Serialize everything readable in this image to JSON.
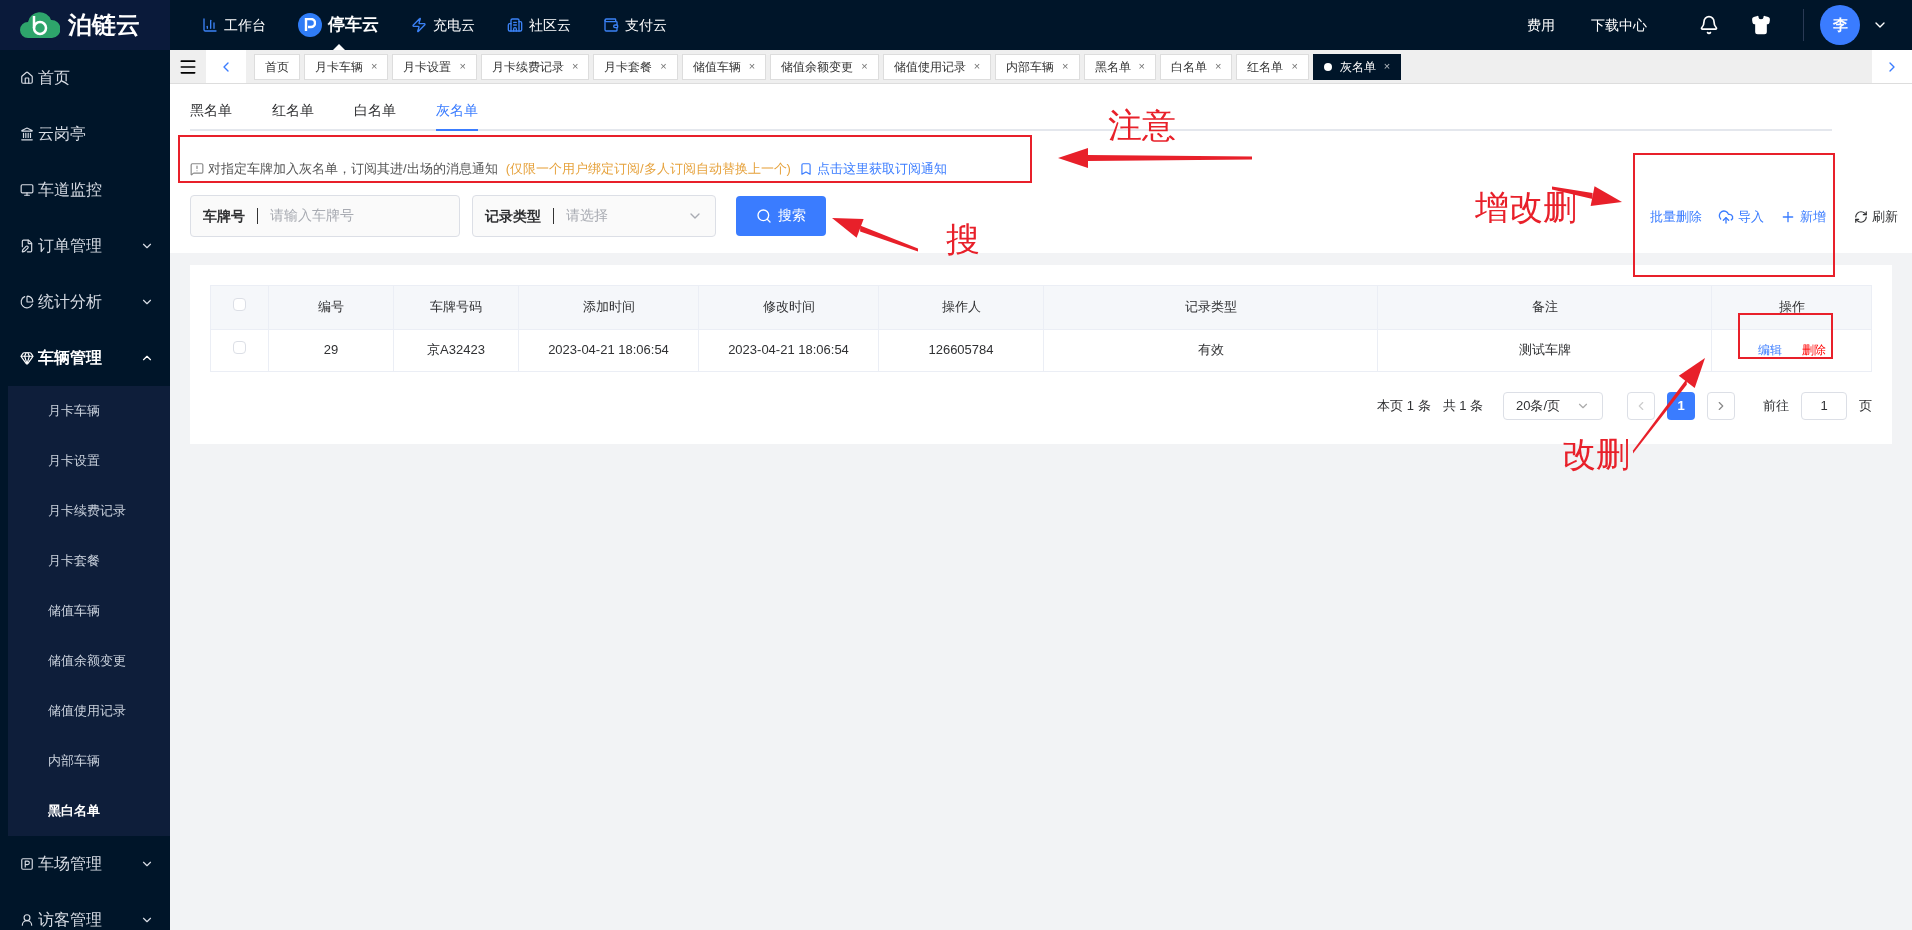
{
  "brand": {
    "name": "泊链云"
  },
  "top_nav": [
    {
      "label": "工作台",
      "selected": false
    },
    {
      "label": "停车云",
      "selected": true
    },
    {
      "label": "充电云",
      "selected": false
    },
    {
      "label": "社区云",
      "selected": false
    },
    {
      "label": "支付云",
      "selected": false
    }
  ],
  "top_right": {
    "links": [
      "费用",
      "下载中心"
    ],
    "avatar": "李"
  },
  "sidebar": {
    "items": [
      {
        "label": "首页",
        "expanded": false,
        "has_children": false
      },
      {
        "label": "云岗亭",
        "expanded": false,
        "has_children": false
      },
      {
        "label": "车道监控",
        "expanded": false,
        "has_children": false
      },
      {
        "label": "订单管理",
        "expanded": false,
        "has_children": true
      },
      {
        "label": "统计分析",
        "expanded": false,
        "has_children": true
      },
      {
        "label": "车辆管理",
        "expanded": true,
        "has_children": true,
        "children": [
          {
            "label": "月卡车辆",
            "selected": false
          },
          {
            "label": "月卡设置",
            "selected": false
          },
          {
            "label": "月卡续费记录",
            "selected": false
          },
          {
            "label": "月卡套餐",
            "selected": false
          },
          {
            "label": "储值车辆",
            "selected": false
          },
          {
            "label": "储值余额变更",
            "selected": false
          },
          {
            "label": "储值使用记录",
            "selected": false
          },
          {
            "label": "内部车辆",
            "selected": false
          },
          {
            "label": "黑白名单",
            "selected": true
          }
        ]
      },
      {
        "label": "车场管理",
        "expanded": false,
        "has_children": true
      },
      {
        "label": "访客管理",
        "expanded": false,
        "has_children": true
      }
    ]
  },
  "page_tabs": [
    {
      "label": "首页",
      "closable": false,
      "selected": false
    },
    {
      "label": "月卡车辆",
      "closable": true,
      "selected": false
    },
    {
      "label": "月卡设置",
      "closable": true,
      "selected": false
    },
    {
      "label": "月卡续费记录",
      "closable": true,
      "selected": false
    },
    {
      "label": "月卡套餐",
      "closable": true,
      "selected": false
    },
    {
      "label": "储值车辆",
      "closable": true,
      "selected": false
    },
    {
      "label": "储值余额变更",
      "closable": true,
      "selected": false
    },
    {
      "label": "储值使用记录",
      "closable": true,
      "selected": false
    },
    {
      "label": "内部车辆",
      "closable": true,
      "selected": false
    },
    {
      "label": "黑名单",
      "closable": true,
      "selected": false
    },
    {
      "label": "白名单",
      "closable": true,
      "selected": false
    },
    {
      "label": "红名单",
      "closable": true,
      "selected": false
    },
    {
      "label": "灰名单",
      "closable": true,
      "selected": true
    }
  ],
  "close_glyph": "×",
  "list_tabs": [
    {
      "label": "黑名单",
      "selected": false
    },
    {
      "label": "红名单",
      "selected": false
    },
    {
      "label": "白名单",
      "selected": false
    },
    {
      "label": "灰名单",
      "selected": true
    }
  ],
  "notice": {
    "text": "对指定车牌加入灰名单，订阅其进/出场的消息通知",
    "warning": "(仅限一个用户绑定订阅/多人订阅自动替换上一个)",
    "link": "点击这里获取订阅通知"
  },
  "filters": [
    {
      "label": "车牌号",
      "kind": "input",
      "placeholder": "请输入车牌号"
    },
    {
      "label": "记录类型",
      "kind": "select",
      "placeholder": "请选择"
    }
  ],
  "search_button": "搜索",
  "actions": [
    {
      "label": "批量删除",
      "kind": "primary"
    },
    {
      "label": "导入",
      "kind": "primary"
    },
    {
      "label": "新增",
      "kind": "primary"
    },
    {
      "label": "刷新",
      "kind": "plain"
    }
  ],
  "table": {
    "columns": [
      "编号",
      "车牌号码",
      "添加时间",
      "修改时间",
      "操作人",
      "记录类型",
      "备注",
      "操作"
    ],
    "rows": [
      {
        "checked": false,
        "cells": [
          "29",
          "京A32423",
          "2023-04-21 18:06:54",
          "2023-04-21 18:06:54",
          "126605784",
          "有效",
          "测试车牌"
        ],
        "actions": [
          {
            "label": "编辑",
            "kind": "edit"
          },
          {
            "label": "删除",
            "kind": "delete"
          }
        ]
      }
    ],
    "header_checked": false
  },
  "pagination": {
    "page_count": "本页 1 条",
    "total": "共 1 条",
    "page_size": "20条/页",
    "pages": [
      {
        "label": "1",
        "selected": true
      }
    ],
    "goto_label": "前往",
    "goto_value": "1",
    "page_suffix": "页"
  },
  "annotations": [
    {
      "label": "注意"
    },
    {
      "label": "搜"
    },
    {
      "label": "增改删"
    },
    {
      "label": "改删"
    }
  ]
}
